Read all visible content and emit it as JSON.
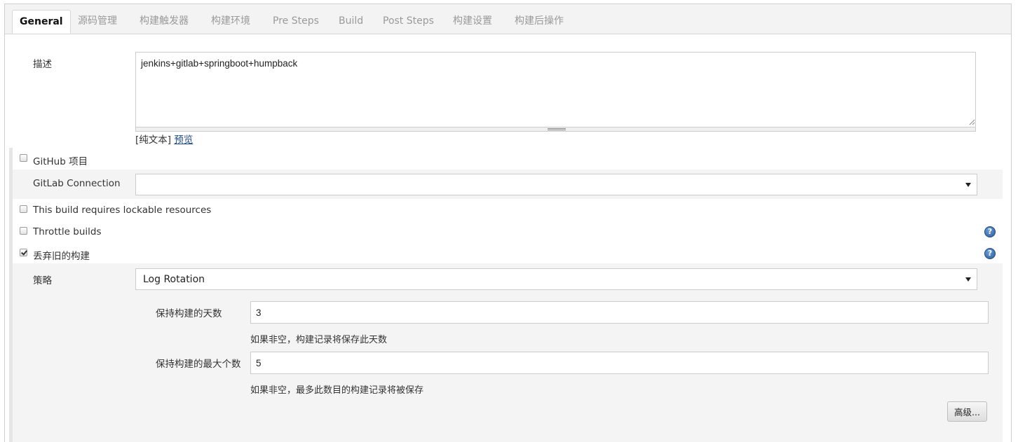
{
  "tabs": [
    {
      "label": "General",
      "active": true
    },
    {
      "label": "源码管理"
    },
    {
      "label": "构建触发器"
    },
    {
      "label": "构建环境"
    },
    {
      "label": "Pre Steps"
    },
    {
      "label": "Build"
    },
    {
      "label": "Post Steps"
    },
    {
      "label": "构建设置"
    },
    {
      "label": "构建后操作"
    }
  ],
  "description": {
    "label": "描述",
    "value": "jenkins+gitlab+springboot+humpback",
    "plain_text": "[纯文本]",
    "preview": "预览"
  },
  "options": {
    "github_project": {
      "label": "GitHub 项目",
      "checked": false
    },
    "gitlab_connection": {
      "label": "GitLab Connection",
      "value": ""
    },
    "lockable_resources": {
      "label": "This build requires lockable resources",
      "checked": false
    },
    "throttle_builds": {
      "label": "Throttle builds",
      "checked": false
    },
    "discard_old_builds": {
      "label": "丢弃旧的构建",
      "checked": true
    }
  },
  "strategy": {
    "label": "策略",
    "value": "Log Rotation",
    "days_to_keep": {
      "label": "保持构建的天数",
      "value": "3",
      "help": "如果非空，构建记录将保存此天数"
    },
    "max_builds": {
      "label": "保持构建的最大个数",
      "value": "5",
      "help": "如果非空，最多此数目的构建记录将被保存"
    },
    "advanced_label": "高级..."
  },
  "icons": {
    "help": "help-icon",
    "dropdown": "chevron-down-icon"
  },
  "colors": {
    "accent_link": "#204a87",
    "help_icon": "#2c5d9b"
  }
}
